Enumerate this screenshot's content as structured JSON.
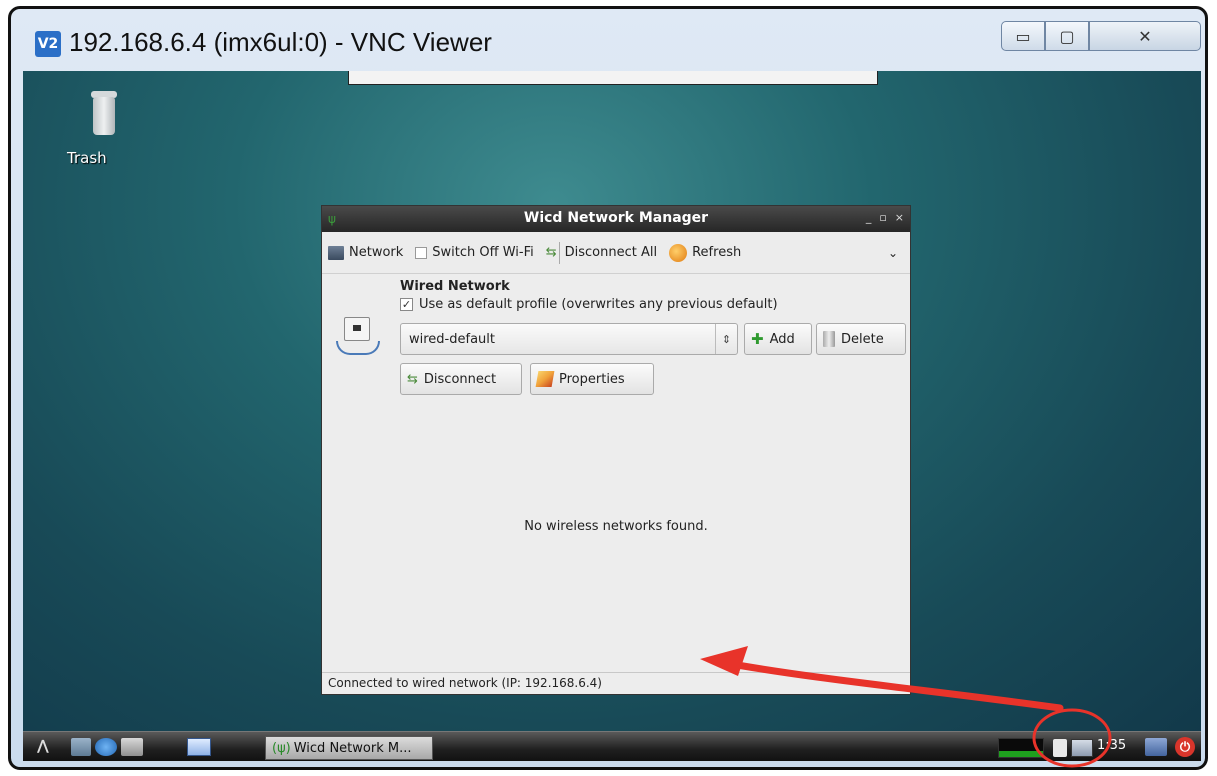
{
  "viewer": {
    "logo_text": "V2",
    "title": "192.168.6.4 (imx6ul:0) - VNC Viewer",
    "minimize_glyph": "▭",
    "maximize_glyph": "▢",
    "close_glyph": "✕"
  },
  "desktop": {
    "trash_label": "Trash"
  },
  "wicd": {
    "title": "Wicd Network Manager",
    "window_controls": [
      "_",
      "▫",
      "×"
    ],
    "toolbar": {
      "network_label": "Network",
      "switch_wifi_label": "Switch Off Wi-Fi",
      "disconnect_all_label": "Disconnect All",
      "refresh_label": "Refresh",
      "more_glyph": "⌄"
    },
    "wired": {
      "heading": "Wired Network",
      "default_profile_label": "Use as default profile (overwrites any previous default)",
      "default_profile_checked": true,
      "profile_value": "wired-default",
      "add_label": "Add",
      "delete_label": "Delete",
      "disconnect_label": "Disconnect",
      "properties_label": "Properties"
    },
    "no_wireless_text": "No wireless networks found.",
    "status_text": "Connected to wired network (IP: 192.168.6.4)"
  },
  "taskbar": {
    "task_label": "Wicd Network M...",
    "clock": "1:35"
  },
  "annotation_color": "#e8332a"
}
